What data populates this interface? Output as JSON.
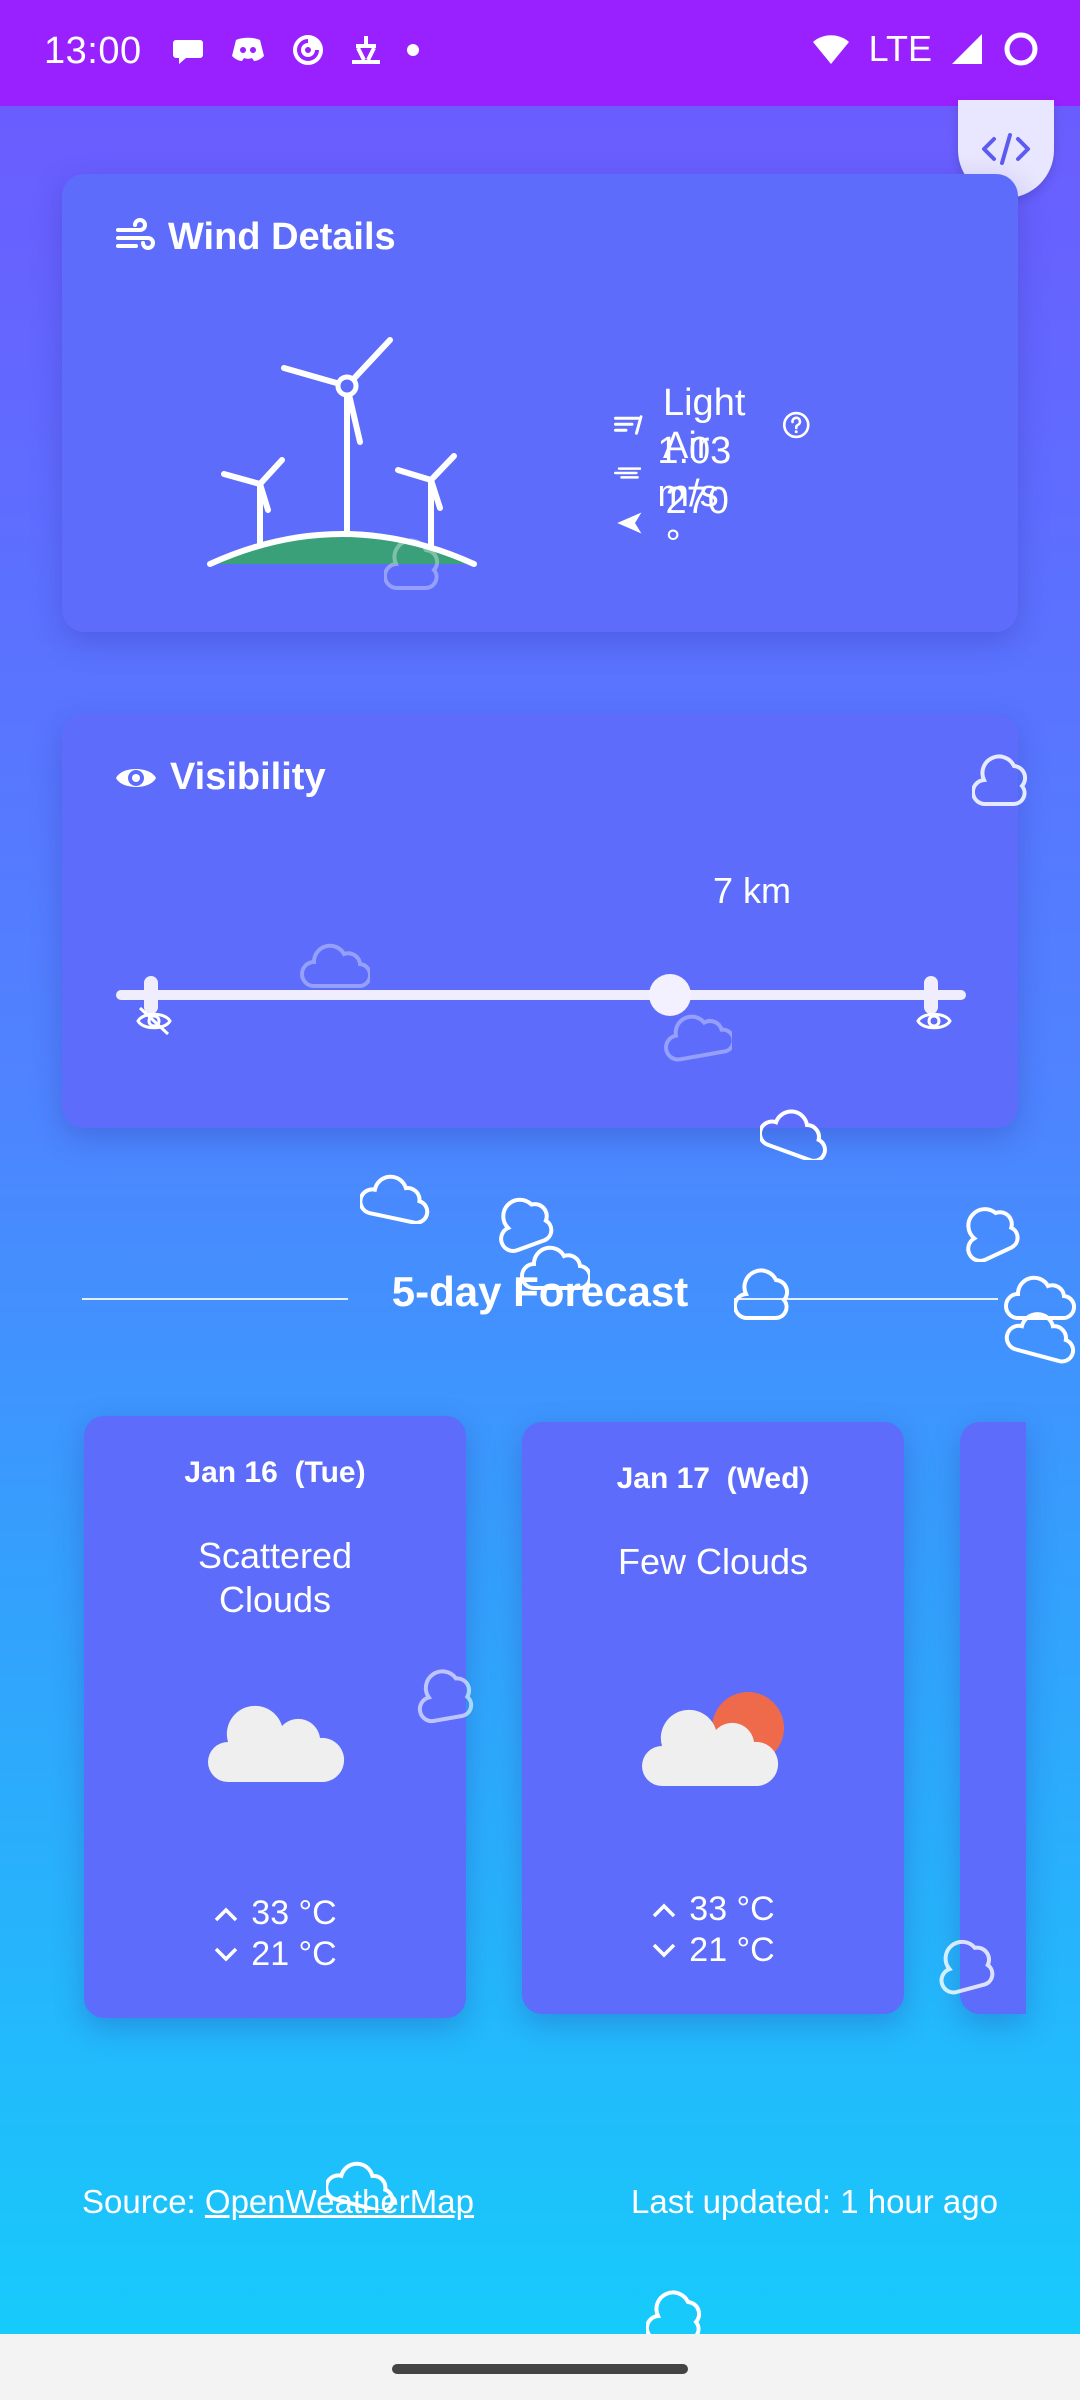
{
  "status": {
    "time": "13:00",
    "network": "LTE"
  },
  "wind": {
    "title": "Wind Details",
    "description": "Light Air",
    "speed": "1.03 m/s",
    "direction": "270 °"
  },
  "visibility": {
    "title": "Visibility",
    "value_text": "7 km",
    "value_fraction": 0.7
  },
  "forecast": {
    "title": "5-day Forecast",
    "days": [
      {
        "date": "Jan 16",
        "weekday": "(Tue)",
        "condition_line1": "Scattered",
        "condition_line2": "Clouds",
        "high": "33 °C",
        "low": "21 °C",
        "icon": "cloud-icon"
      },
      {
        "date": "Jan 17",
        "weekday": "(Wed)",
        "condition_line1": "Few Clouds",
        "condition_line2": "",
        "high": "33 °C",
        "low": "21 °C",
        "icon": "sun-cloud-icon"
      }
    ]
  },
  "footer": {
    "source_label": "Source: ",
    "source_link": "OpenWeatherMap",
    "updated": "Last updated: 1 hour ago"
  },
  "colors": {
    "status_bar": "#9920ff",
    "card": "#5d6cfa",
    "accent_sun": "#ef6a4b",
    "turbine_hill": "#3aa07a"
  }
}
